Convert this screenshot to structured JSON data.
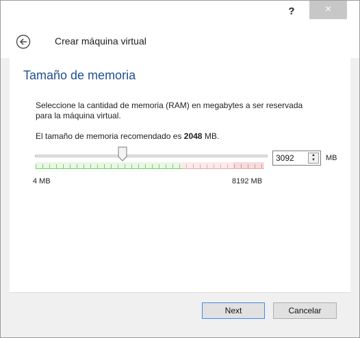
{
  "titlebar": {
    "help_label": "?",
    "close_label": "×"
  },
  "header": {
    "title": "Crear máquina virtual",
    "back_icon": "back-arrow-circle-icon"
  },
  "page": {
    "title": "Tamaño de memoria",
    "description": "Seleccione la cantidad de memoria (RAM) en megabytes a ser reservada para la máquina virtual.",
    "recommend_prefix": "El tamaño de memoria recomendado es ",
    "recommend_value": "2048",
    "recommend_suffix": " MB."
  },
  "memory": {
    "slider_min_label": "4 MB",
    "slider_max_label": "8192 MB",
    "slider_min": 4,
    "slider_max": 8192,
    "value": "3092",
    "unit": "MB",
    "colors": {
      "safe": "#6fcf62",
      "warning": "#e9a7a7",
      "danger": "#e28b8b"
    }
  },
  "buttons": {
    "next": "Next",
    "cancel": "Cancelar"
  }
}
